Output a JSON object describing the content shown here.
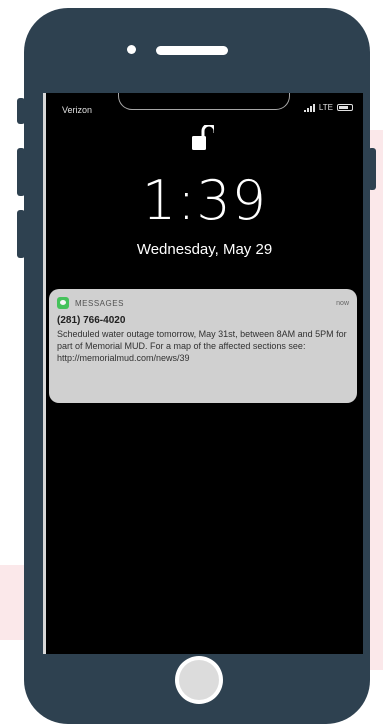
{
  "status_bar": {
    "carrier": "Verizon",
    "network": "LTE"
  },
  "lock_screen": {
    "time": "1:39",
    "date": "Wednesday, May 29",
    "lock_icon": "unlocked-padlock-icon"
  },
  "notification": {
    "app_icon": "messages-icon",
    "app_name": "MESSAGES",
    "timestamp": "now",
    "sender": "(281) 766-4020",
    "body": "Scheduled water outage tomorrow, May 31st, between 8AM and 5PM for part of Memorial MUD. For a map of the affected sections see: http://memorialmud.com/news/39"
  },
  "colors": {
    "phone_body": "#2e4150",
    "screen": "#000000",
    "notification_bg": "#d7d7d7",
    "messages_green": "#48c95e",
    "background_accent": "#fbe8ea"
  }
}
